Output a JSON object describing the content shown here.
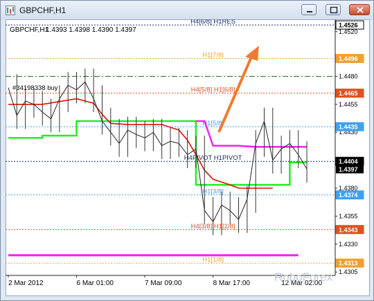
{
  "window": {
    "title": "GBPCHF,H1",
    "buttons": [
      "minimize",
      "maximize",
      "close"
    ]
  },
  "header": {
    "symbol": "GBPCHF,H1",
    "ohlc": "1.4393 1.4398 1.4390 1.4397"
  },
  "watermark": "RoboForex",
  "colors": {
    "price": "#222222",
    "green_line": "#22ee22",
    "red_line": "#dd1100",
    "magenta": "#ee22ee",
    "arrow": "#f07a30",
    "level_blue": "#2255aa",
    "level_orange": "#f0a030",
    "level_red": "#e05020",
    "level_light_blue": "#40a0f0",
    "order_green": "#226622"
  },
  "chart_data": {
    "type": "line",
    "title": "",
    "xlabel": "",
    "ylabel": "",
    "ylim": [
      1.4302,
      1.4531
    ],
    "y_ticks": [
      {
        "value": 1.452,
        "label": "1.4520"
      },
      {
        "value": 1.448,
        "label": "1.4480"
      },
      {
        "value": 1.4455,
        "label": "1.4455"
      },
      {
        "value": 1.443,
        "label": "1.4430"
      },
      {
        "value": 1.438,
        "label": "1.4380"
      },
      {
        "value": 1.4355,
        "label": "1.4355"
      },
      {
        "value": 1.433,
        "label": "1.4330"
      },
      {
        "value": 1.4305,
        "label": "1.4305"
      }
    ],
    "x_ticks": [
      {
        "x": 0,
        "label": "2 Mar 2012"
      },
      {
        "x": 16,
        "label": "6 Mar 01:00"
      },
      {
        "x": 32,
        "label": "7 Mar 09:00"
      },
      {
        "x": 48,
        "label": "8 Mar 17:00"
      },
      {
        "x": 64,
        "label": "12 Mar 02:00"
      }
    ],
    "x_range": [
      0,
      76
    ],
    "levels": [
      {
        "name": "H4[6/8] H1RES",
        "value": 1.4526,
        "color": "#1a2a66",
        "dash": "2,2",
        "tag": "1.4526",
        "tag_bg": "#ffffff",
        "tag_fg": "#000000",
        "label_x": 48
      },
      {
        "name": "H1[7/8]",
        "value": 1.4496,
        "color": "#f0a030",
        "dash": "2,2",
        "tag": "1.4496",
        "tag_bg": "#f0a030",
        "tag_fg": "#ffffff",
        "label_x": 48
      },
      {
        "name": "",
        "value": 1.448,
        "color": "#226622",
        "dash": "8,3,2,3",
        "tag": "",
        "tag_bg": "",
        "tag_fg": "",
        "label_x": 0
      },
      {
        "name": "H4[5/8] H1[6/8]",
        "value": 1.4465,
        "color": "#e05020",
        "dash": "2,2",
        "tag": "1.4465",
        "tag_bg": "#e05020",
        "tag_fg": "#ffffff",
        "label_x": 48
      },
      {
        "name": "H1[5/8]",
        "value": 1.4435,
        "color": "#40a0f0",
        "dash": "2,2",
        "tag": "1.4435",
        "tag_bg": "#40a0f0",
        "tag_fg": "#ffffff",
        "label_x": 48
      },
      {
        "name": "H4PIVOT H1PIVOT",
        "value": 1.4404,
        "color": "#1a2a66",
        "dash": "2,2",
        "tag": "1.4404",
        "tag_bg": "#000000",
        "tag_fg": "#ffffff",
        "label_x": 48
      },
      {
        "name": "H1[3/8]",
        "value": 1.4374,
        "color": "#40a0f0",
        "dash": "2,2",
        "tag": "1.4374",
        "tag_bg": "#40a0f0",
        "tag_fg": "#ffffff",
        "label_x": 48
      },
      {
        "name": "H4[3/8] H1[2/8]",
        "value": 1.4343,
        "color": "#e05020",
        "dash": "2,2",
        "tag": "1.4343",
        "tag_bg": "#e05020",
        "tag_fg": "#ffffff",
        "label_x": 48
      },
      {
        "name": "H1[1/8]",
        "value": 1.4313,
        "color": "#f0a030",
        "dash": "2,2",
        "tag": "1.4313",
        "tag_bg": "#f0a030",
        "tag_fg": "#ffffff",
        "label_x": 48
      }
    ],
    "current_price": {
      "value": 1.4397,
      "tag": "1.4397"
    },
    "order_label": "#34198338 buy",
    "series": [
      {
        "name": "",
        "kind": "price",
        "color": "#222222",
        "x": [
          0,
          2,
          4,
          6,
          8,
          10,
          12,
          14,
          16,
          18,
          20,
          22,
          24,
          26,
          28,
          30,
          32,
          34,
          36,
          38,
          40,
          42,
          44,
          46,
          48,
          50,
          52,
          54,
          56,
          58,
          60,
          62,
          64,
          66,
          68,
          70
        ],
        "y": [
          1.447,
          1.4445,
          1.4458,
          1.4455,
          1.4448,
          1.4442,
          1.446,
          1.4472,
          1.4468,
          1.4475,
          1.446,
          1.444,
          1.443,
          1.442,
          1.4432,
          1.4428,
          1.4425,
          1.443,
          1.4418,
          1.4422,
          1.442,
          1.441,
          1.4415,
          1.436,
          1.435,
          1.4365,
          1.436,
          1.4352,
          1.437,
          1.442,
          1.444,
          1.4405,
          1.4415,
          1.442,
          1.441,
          1.4397
        ]
      },
      {
        "name": "",
        "kind": "green_step",
        "color": "#22ee22",
        "x": [
          0,
          8,
          8,
          16,
          16,
          30,
          30,
          44,
          44,
          60,
          60,
          66,
          66,
          70
        ],
        "y": [
          1.4425,
          1.4425,
          1.4427,
          1.4427,
          1.444,
          1.444,
          1.444,
          1.444,
          1.4383,
          1.4383,
          1.4383,
          1.4383,
          1.4403,
          1.4403
        ]
      },
      {
        "name": "",
        "kind": "red_line",
        "color": "#dd1100",
        "x": [
          0,
          8,
          16,
          20,
          22,
          24,
          28,
          36,
          40,
          42,
          44,
          46,
          48,
          52,
          54,
          58,
          62
        ],
        "y": [
          1.4455,
          1.4455,
          1.446,
          1.4456,
          1.4446,
          1.4438,
          1.4437,
          1.4437,
          1.4432,
          1.4423,
          1.441,
          1.4396,
          1.4388,
          1.4383,
          1.438,
          1.438,
          1.438
        ]
      },
      {
        "name": "",
        "kind": "magenta_upper",
        "color": "#ee22ee",
        "x": [
          44,
          46,
          48,
          54,
          58,
          62,
          66,
          70
        ],
        "y": [
          1.444,
          1.444,
          1.4418,
          1.4418,
          1.4417,
          1.4417,
          1.4417,
          1.4417
        ]
      },
      {
        "name": "",
        "kind": "magenta_lower",
        "color": "#ee22ee",
        "x": [
          0,
          68
        ],
        "y": [
          1.432,
          1.432
        ]
      }
    ]
  }
}
